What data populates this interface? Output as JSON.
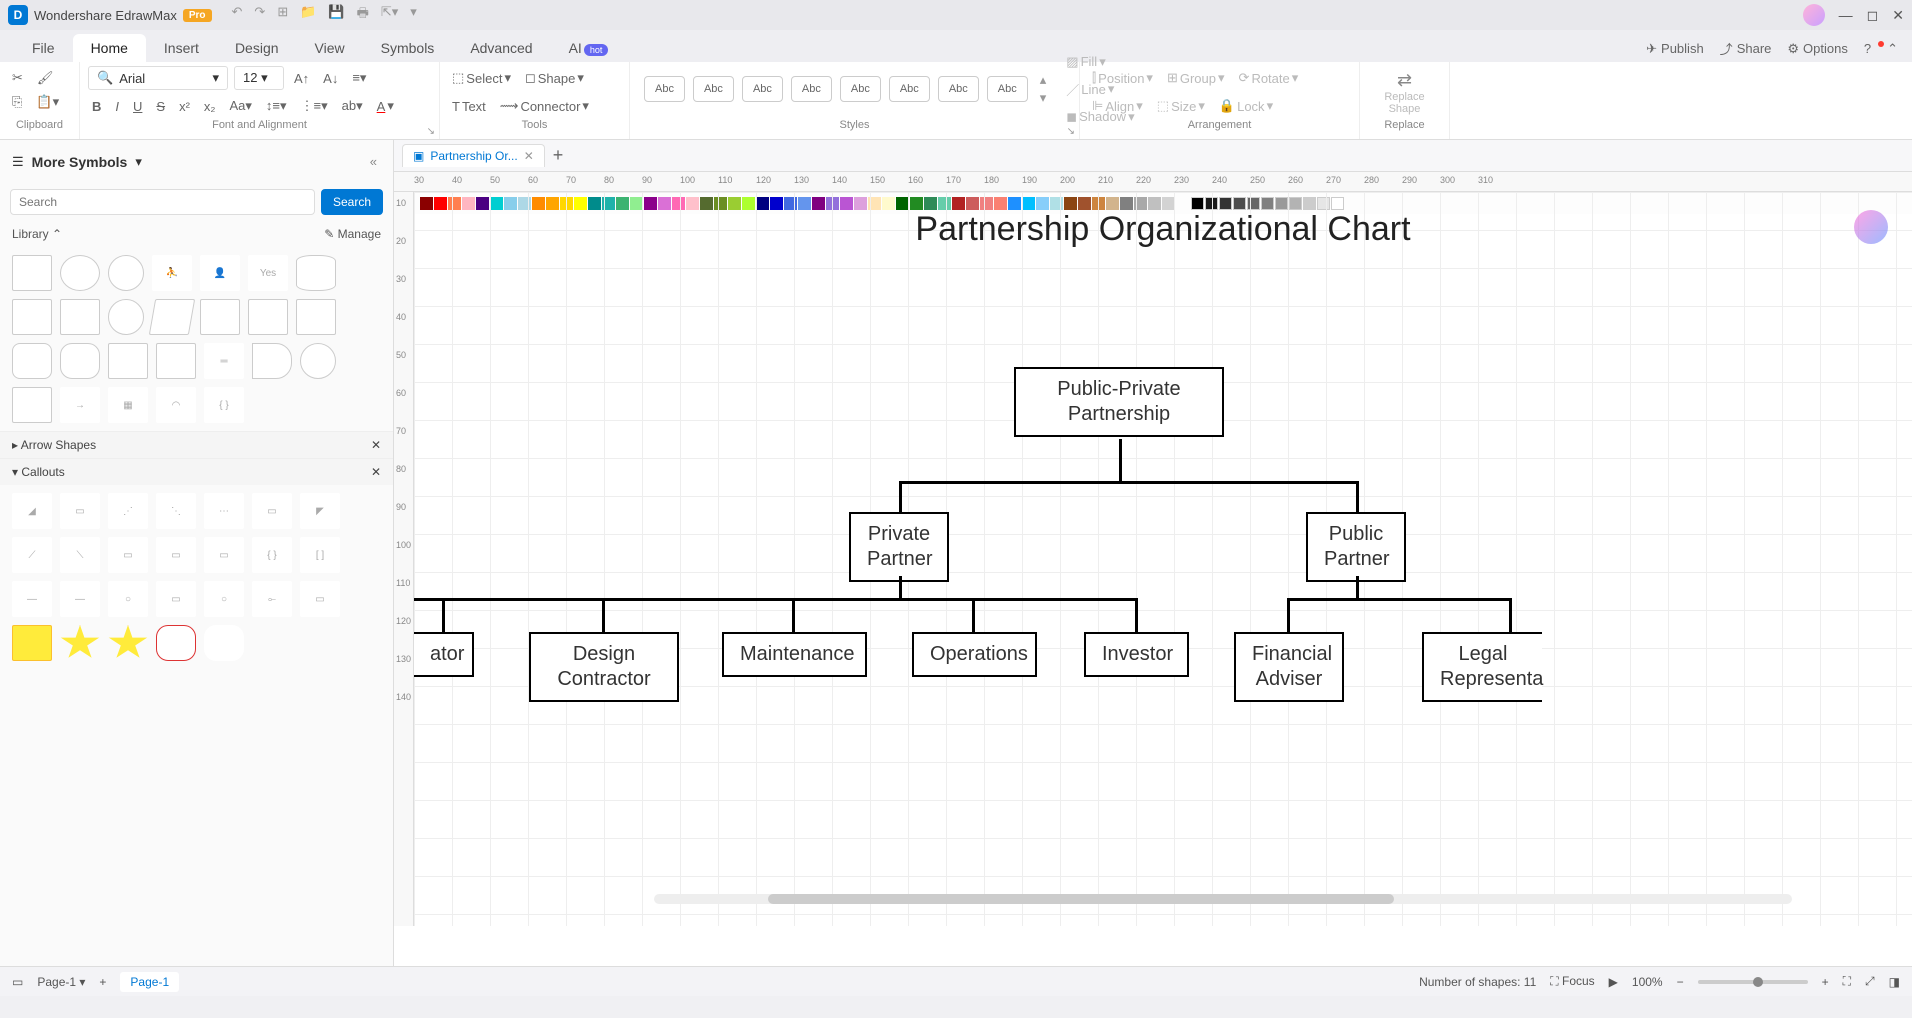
{
  "app": {
    "name": "Wondershare EdrawMax",
    "badge": "Pro"
  },
  "menu": {
    "tabs": [
      "File",
      "Home",
      "Insert",
      "Design",
      "View",
      "Symbols",
      "Advanced",
      "AI"
    ],
    "active": 1,
    "hot": "hot",
    "right": {
      "publish": "Publish",
      "share": "Share",
      "options": "Options"
    }
  },
  "ribbon": {
    "clipboard_label": "Clipboard",
    "font_label": "Font and Alignment",
    "tools_label": "Tools",
    "styles_label": "Styles",
    "arrangement_label": "Arrangement",
    "replace_label": "Replace",
    "font_name": "Arial",
    "font_size": "12",
    "select": "Select",
    "text": "Text",
    "shape": "Shape",
    "connector": "Connector",
    "style_swatch": "Abc",
    "fill": "Fill",
    "line": "Line",
    "shadow": "Shadow",
    "position": "Position",
    "align": "Align",
    "group": "Group",
    "size": "Size",
    "rotate": "Rotate",
    "lock": "Lock",
    "replace_shape": "Replace Shape"
  },
  "sidebar": {
    "title": "More Symbols",
    "search_placeholder": "Search",
    "search_btn": "Search",
    "library": "Library",
    "manage": "Manage",
    "arrow_shapes": "Arrow Shapes",
    "callouts": "Callouts",
    "yes_label": "Yes"
  },
  "document": {
    "tab_name": "Partnership Or...",
    "title": "Partnership Organizational Chart",
    "ruler_h": [
      "30",
      "40",
      "50",
      "60",
      "70",
      "80",
      "90",
      "100",
      "110",
      "120",
      "130",
      "140",
      "150",
      "160",
      "170",
      "180",
      "190",
      "200",
      "210",
      "220",
      "230",
      "240",
      "250",
      "260",
      "270",
      "280",
      "290",
      "300",
      "310"
    ],
    "ruler_v": [
      "10",
      "20",
      "30",
      "40",
      "50",
      "60",
      "70",
      "80",
      "90",
      "100",
      "110",
      "120",
      "130",
      "140"
    ]
  },
  "chart_data": {
    "type": "tree",
    "root": {
      "label": "Public-Private Partnership"
    },
    "level2": [
      {
        "label": "Private Partner"
      },
      {
        "label": "Public Partner"
      }
    ],
    "level3_private": [
      {
        "label": "ator",
        "partial_left": true
      },
      {
        "label": "Design Contractor"
      },
      {
        "label": "Maintenance"
      },
      {
        "label": "Operations"
      },
      {
        "label": "Investor"
      }
    ],
    "level3_public": [
      {
        "label": "Financial Adviser"
      },
      {
        "label": "Legal Representa",
        "partial_right": true
      }
    ]
  },
  "status": {
    "page_selector": "Page-1",
    "page_tab": "Page-1",
    "shapes": "Number of shapes: 11",
    "focus": "Focus",
    "zoom": "100%"
  }
}
